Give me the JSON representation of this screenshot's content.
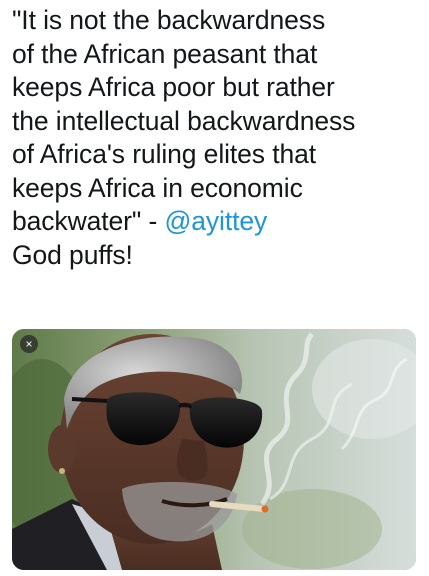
{
  "tweet": {
    "lines": [
      "\"It is not the backwardness",
      "of the African peasant that",
      "keeps Africa poor but rather",
      "the intellectual backwardness",
      "of Africa's ruling elites that",
      "keeps Africa in economic"
    ],
    "last_line_prefix": "backwater\" - ",
    "mention": "@ayittey",
    "comment": "God puffs!"
  },
  "media": {
    "close_label": "×",
    "colors": {
      "mention": "#1b95e0"
    }
  }
}
